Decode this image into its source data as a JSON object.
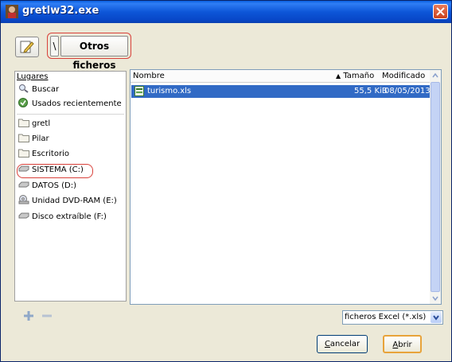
{
  "window": {
    "title": "gretlw32.exe"
  },
  "path_bar": {
    "root_label": "\\",
    "current_folder": "Otros ficheros"
  },
  "places": {
    "header": "Lugares",
    "items": [
      {
        "label": "Buscar",
        "icon": "search-icon"
      },
      {
        "label": "Usados recientemente",
        "icon": "recent-icon"
      },
      {
        "label": "gretl",
        "icon": "folder-icon"
      },
      {
        "label": "Pilar",
        "icon": "folder-icon"
      },
      {
        "label": "Escritorio",
        "icon": "folder-icon"
      },
      {
        "label": "SISTEMA (C:)",
        "icon": "drive-icon"
      },
      {
        "label": "DATOS (D:)",
        "icon": "drive-icon"
      },
      {
        "label": "Unidad DVD-RAM (E:)",
        "icon": "dvd-icon"
      },
      {
        "label": "Disco extraíble (F:)",
        "icon": "drive-icon"
      }
    ]
  },
  "files": {
    "columns": {
      "name": "Nombre",
      "size": "Tamaño",
      "modified": "Modificado"
    },
    "sort_column": "size",
    "rows": [
      {
        "name": "turismo.xls",
        "size": "55,5 KiB",
        "modified": "08/05/2013",
        "icon": "spreadsheet-icon",
        "selected": true
      }
    ]
  },
  "filter": {
    "selected": "ficheros Excel (*.xls)"
  },
  "buttons": {
    "cancel_mnemonic": "C",
    "cancel_rest": "ancelar",
    "open_mnemonic": "A",
    "open_rest": "brir"
  },
  "colors": {
    "title_bar": "#0a5fe0",
    "selection": "#316ac5",
    "highlight_ring": "#d9413a",
    "default_button_border": "#e8a33a"
  }
}
